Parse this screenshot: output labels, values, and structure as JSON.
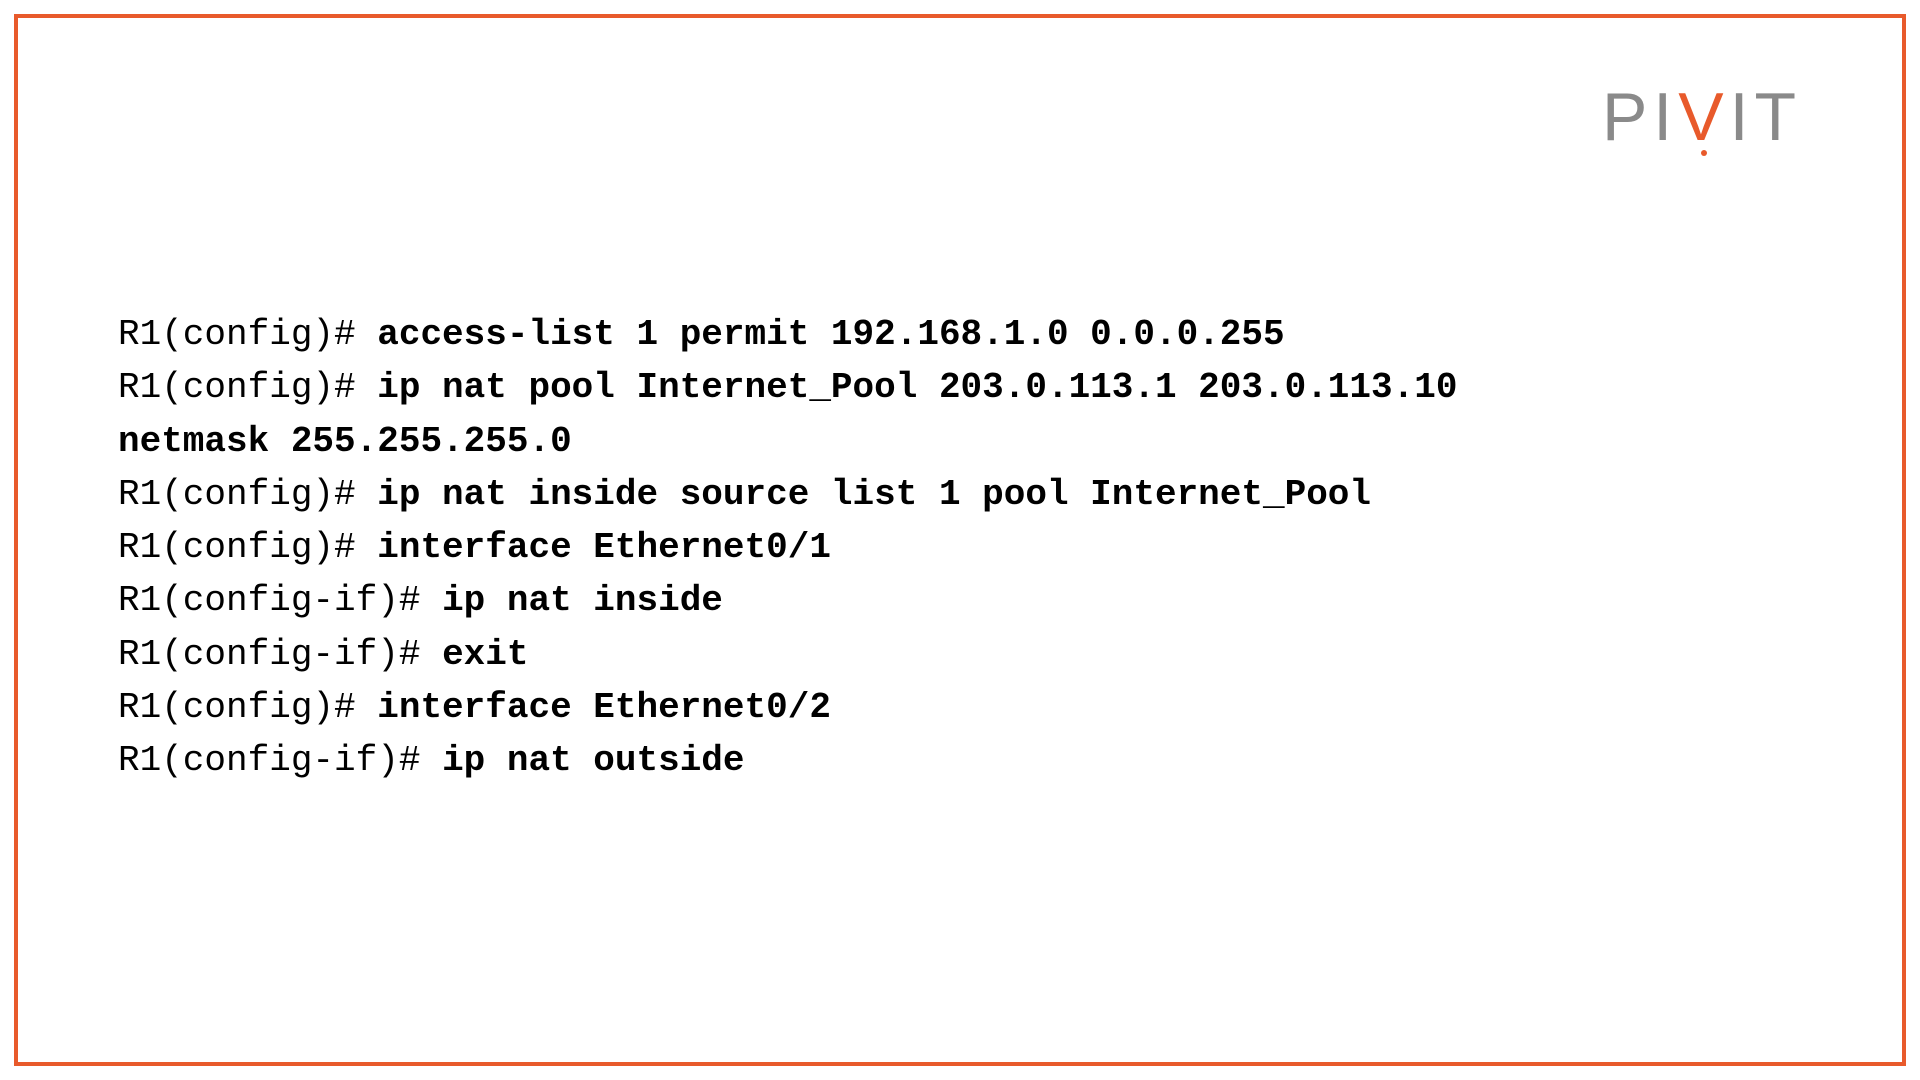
{
  "logo": {
    "part1": "PI",
    "accent": "V",
    "part2": "IT"
  },
  "terminal": {
    "lines": [
      {
        "prompt": "R1(config)# ",
        "command": "access-list 1 permit 192.168.1.0 0.0.0.255",
        "continuation": ""
      },
      {
        "prompt": "R1(config)# ",
        "command": "ip nat pool Internet_Pool 203.0.113.1 203.0.113.10",
        "continuation": "netmask 255.255.255.0"
      },
      {
        "prompt": "R1(config)# ",
        "command": "ip nat inside source list 1 pool Internet_Pool",
        "continuation": ""
      },
      {
        "prompt": "R1(config)# ",
        "command": "interface Ethernet0/1",
        "continuation": ""
      },
      {
        "prompt": "R1(config-if)# ",
        "command": "ip nat inside",
        "continuation": ""
      },
      {
        "prompt": "R1(config-if)# ",
        "command": "exit",
        "continuation": ""
      },
      {
        "prompt": "R1(config)# ",
        "command": "interface Ethernet0/2",
        "continuation": ""
      },
      {
        "prompt": "R1(config-if)# ",
        "command": "ip nat outside",
        "continuation": ""
      }
    ]
  }
}
